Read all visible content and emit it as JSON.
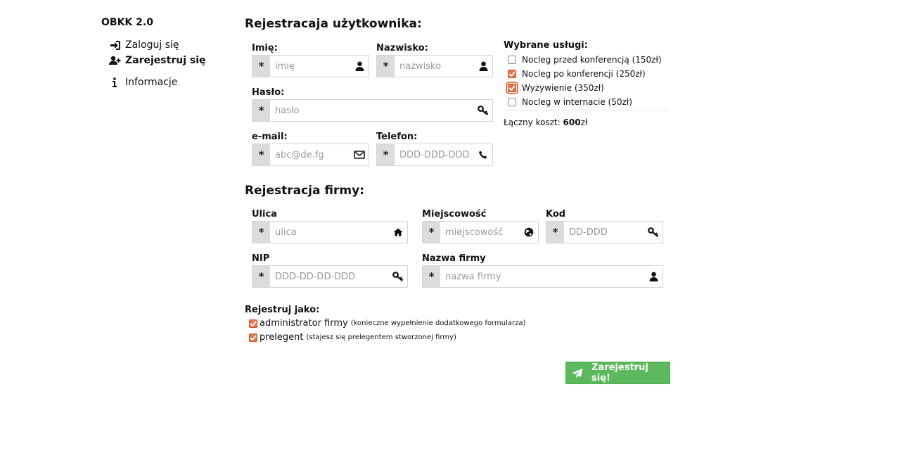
{
  "sidebar": {
    "brand": "OBKK 2.0",
    "items": [
      {
        "label": "Zaloguj się",
        "icon": "sign-in-icon"
      },
      {
        "label": "Zarejestruj się",
        "icon": "user-plus-icon"
      },
      {
        "label": "Informacje",
        "icon": "info-icon"
      }
    ]
  },
  "user_section": {
    "title": "Rejestracaja użytkownika:",
    "first_name": {
      "label": "Imię:",
      "placeholder": "imię",
      "required_mark": "*"
    },
    "last_name": {
      "label": "Nazwisko:",
      "placeholder": "nazwisko",
      "required_mark": "*"
    },
    "password": {
      "label": "Hasło:",
      "placeholder": "hasło",
      "required_mark": "*"
    },
    "email": {
      "label": "e-mail:",
      "placeholder": "abc@de.fg",
      "required_mark": "*"
    },
    "phone": {
      "label": "Telefon:",
      "placeholder": "DDD-DDD-DDD",
      "required_mark": "*"
    }
  },
  "services": {
    "title": "Wybrane usługi:",
    "items": [
      {
        "label": "Nocleg przed konferencją (150zł)",
        "checked": false
      },
      {
        "label": "Nocleg po konferencji (250zł)",
        "checked": true
      },
      {
        "label": "Wyżywienie (350zł)",
        "checked": true
      },
      {
        "label": "Nocleg w internacie (50zł)",
        "checked": false
      }
    ],
    "total_label": "Łączny koszt:",
    "total_value": "600",
    "total_unit": "zł"
  },
  "company_section": {
    "title": "Rejestracja firmy:",
    "street": {
      "label": "Ulica",
      "placeholder": "ulica",
      "required_mark": "*"
    },
    "city": {
      "label": "Miejscowość",
      "placeholder": "miejscowość",
      "required_mark": "*"
    },
    "postcode": {
      "label": "Kod",
      "placeholder": "DD-DDD",
      "required_mark": "*"
    },
    "nip": {
      "label": "NIP",
      "placeholder": "DDD-DD-DD-DDD",
      "required_mark": "*"
    },
    "company_name": {
      "label": "Nazwa firmy",
      "placeholder": "nazwa firmy",
      "required_mark": "*"
    }
  },
  "register_as": {
    "title": "Rejestruj jako:",
    "roles": [
      {
        "label": "administrator firmy",
        "note": "(konieczne wypełnienie dodatkowego formularza)",
        "checked": true
      },
      {
        "label": "prelegent",
        "note": "(stajesz się prelegentem stworzonej firmy)",
        "checked": true
      }
    ]
  },
  "submit": {
    "label": "Zarejestruj się!"
  },
  "colors": {
    "accent_orange": "#e8734a",
    "submit_green": "#5cb85c",
    "required_bg": "#dcdcdc"
  }
}
